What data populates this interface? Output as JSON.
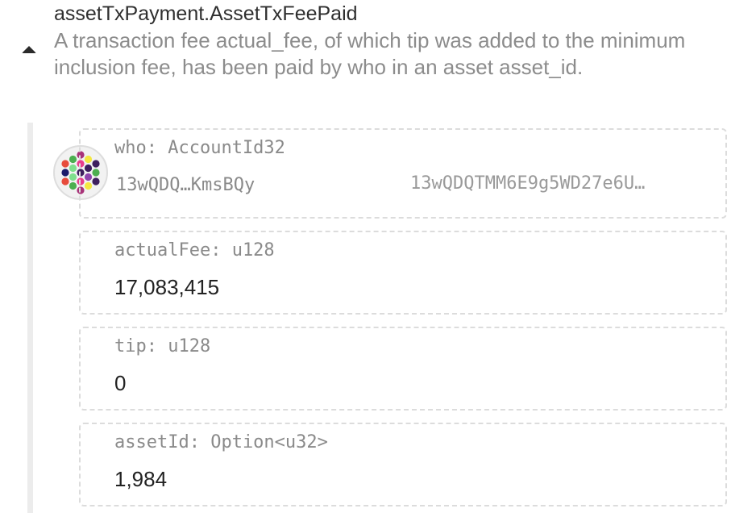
{
  "event": {
    "title": "assetTxPayment.AssetTxFeePaid",
    "description": "A transaction fee actual_fee, of which tip was added to the minimum inclusion fee, has been paid by who in an asset asset_id."
  },
  "params": {
    "who": {
      "label": "who: AccountId32",
      "short": "13wQDQ…KmsBQy",
      "full": "13wQDQTMM6E9g5WD27e6U…",
      "icon": "identicon"
    },
    "actual_fee": {
      "label": "actualFee: u128",
      "value": "17,083,415"
    },
    "tip": {
      "label": "tip: u128",
      "value": "0"
    },
    "asset_id": {
      "label": "assetId: Option<u32>",
      "value": "1,984"
    }
  },
  "colors": {
    "text_primary": "#2f2f2f",
    "text_muted": "#8c8c8c",
    "border_dashed": "#dcdcdc",
    "rail": "#ececec"
  }
}
